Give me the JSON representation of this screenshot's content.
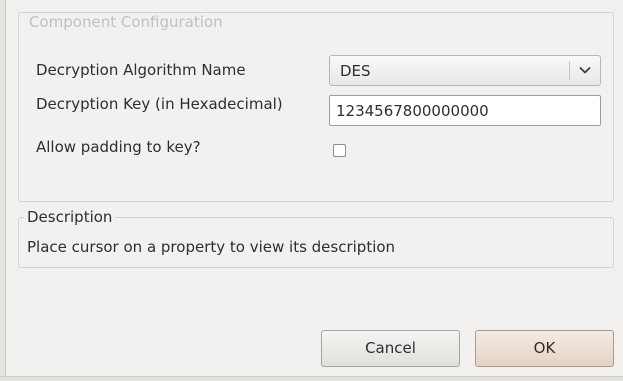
{
  "config": {
    "legend": "Component Configuration",
    "algorithm": {
      "label": "Decryption Algorithm Name",
      "selected": "DES",
      "icon": "chevron-down-icon"
    },
    "key": {
      "label": "Decryption Key (in Hexadecimal)",
      "value": "1234567800000000"
    },
    "padding": {
      "label": "Allow padding to key?",
      "checked": false
    }
  },
  "description": {
    "legend": "Description",
    "text": "Place cursor on a property to view its description"
  },
  "buttons": {
    "cancel": "Cancel",
    "ok": "OK"
  }
}
